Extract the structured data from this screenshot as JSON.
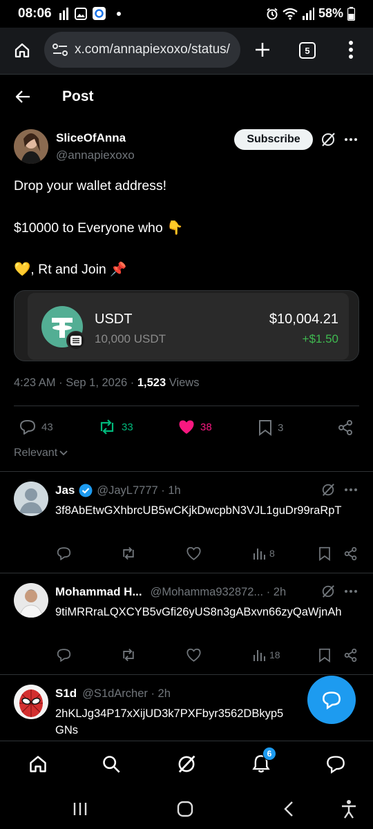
{
  "status_bar": {
    "time": "08:06",
    "battery": "58%",
    "icons": [
      "signal-bars-icon",
      "gallery-icon",
      "app-notification-icon",
      "dot-icon",
      "alarm-icon",
      "wifi-icon",
      "cell-signal-icon",
      "battery-icon"
    ]
  },
  "browser": {
    "url": "x.com/annapiexoxo/status/",
    "tab_count": "5"
  },
  "header": {
    "title": "Post"
  },
  "post": {
    "author_name": "SliceOfAnna",
    "handle": "@annapiexoxo",
    "subscribe_label": "Subscribe",
    "lines": [
      "Drop your wallet address!",
      "$10000 to Everyone who 👇",
      "💛, Rt and Join 📌"
    ],
    "wallet": {
      "token": "USDT",
      "token_amount": "10,000 USDT",
      "usd_value": "$10,004.21",
      "change": "+$1.50"
    },
    "meta": {
      "time": "4:23 AM · Sep 1, 2026 · ",
      "views_count": "1,523",
      "views_label": " Views"
    },
    "actions": {
      "replies": "43",
      "reposts": "33",
      "likes": "38",
      "bookmarks": "3"
    },
    "sort_label": "Relevant"
  },
  "replies": [
    {
      "name": "Jas",
      "handle": "@JayL7777 · 1h",
      "text": "3f8AbEtwGXhbrcUB5wCKjkDwcpbN3VJL1guDr99raRpT",
      "views": "8"
    },
    {
      "name": "Mohammad H...",
      "handle": "@Mohamma932872... · 2h",
      "text": "9tiMRRraLQXCYB5vGfi26yUS8n3gABxvn66zyQaWjnAh",
      "views": "18"
    },
    {
      "name": "S1d",
      "handle": "@S1dArcher · 2h",
      "text": "2hKLJg34P17xXijUD3k7PXFbyr3562DBkyp5",
      "text2": "GNs"
    }
  ],
  "bottom_nav": {
    "items": [
      "home-icon",
      "search-icon",
      "grok-icon",
      "notifications-icon",
      "messages-icon"
    ],
    "notification_count": "6"
  },
  "colors": {
    "accent": "#1d9bf0",
    "like": "#f91880",
    "repost": "#00ba7c",
    "tether": "#53ae94"
  }
}
